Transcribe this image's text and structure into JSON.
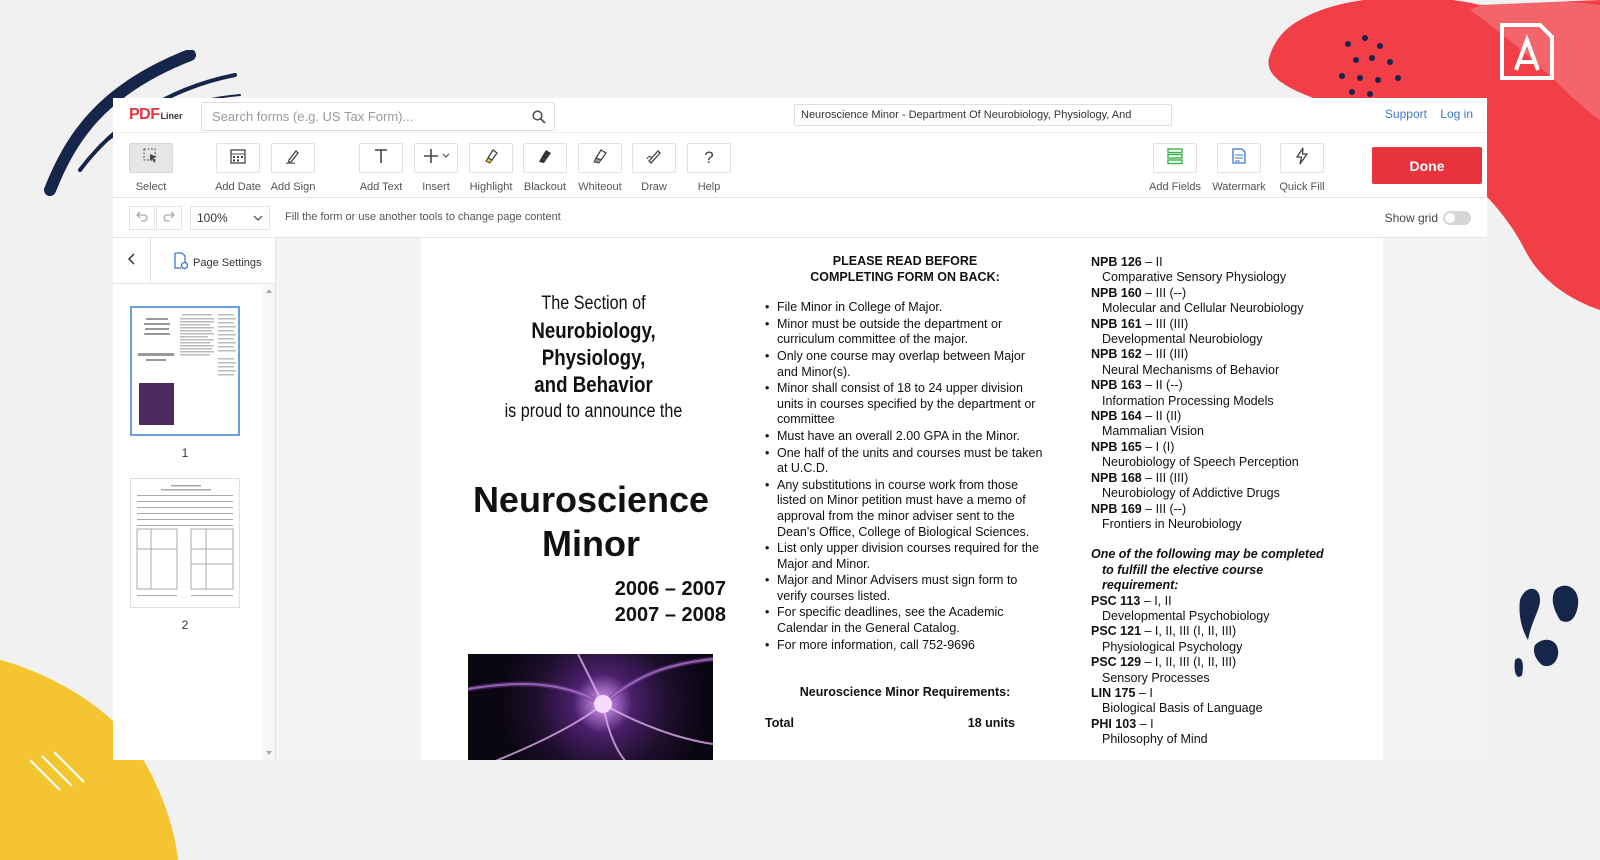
{
  "topbar": {
    "logo_pdf": "PDF",
    "logo_liner": "Liner",
    "search_placeholder": "Search forms (e.g. US Tax Form)...",
    "doc_title": "Neuroscience Minor - Department Of Neurobiology, Physiology, And",
    "links": [
      "Support",
      "Log in"
    ]
  },
  "toolbar": {
    "tools": [
      {
        "label": "Select",
        "icon": "select-icon"
      },
      {
        "label": "Add Date",
        "icon": "calendar-icon"
      },
      {
        "label": "Add Sign",
        "icon": "sign-icon"
      },
      {
        "label": "Add Text",
        "icon": "text-icon"
      },
      {
        "label": "Insert",
        "icon": "plus-icon"
      },
      {
        "label": "Highlight",
        "icon": "highlight-icon"
      },
      {
        "label": "Blackout",
        "icon": "blackout-icon"
      },
      {
        "label": "Whiteout",
        "icon": "whiteout-icon"
      },
      {
        "label": "Draw",
        "icon": "draw-icon"
      },
      {
        "label": "Help",
        "icon": "help-icon"
      },
      {
        "label": "Add Fields",
        "icon": "fields-icon"
      },
      {
        "label": "Watermark",
        "icon": "watermark-icon"
      },
      {
        "label": "Quick Fill",
        "icon": "lightning-icon"
      }
    ],
    "done_label": "Done"
  },
  "subbar": {
    "zoom": "100%",
    "hint": "Fill the form or use another tools to change page content",
    "show_grid_label": "Show grid"
  },
  "sidebar": {
    "page_settings_label": "Page Settings",
    "pages": [
      "1",
      "2"
    ]
  },
  "document": {
    "intro": {
      "line1": "The Section of",
      "line2": "Neurobiology,",
      "line3": "Physiology,",
      "line4": "and Behavior",
      "line5": "is proud to announce the"
    },
    "big_title_1": "Neuroscience",
    "big_title_2": "Minor",
    "years": [
      "2006 – 2007",
      "2007 – 2008"
    ],
    "read_header_1": "PLEASE READ BEFORE",
    "read_header_2": "COMPLETING FORM ON BACK:",
    "bullets": [
      "File Minor in College of Major.",
      "Minor must be outside the department or curriculum committee of the major.",
      "Only one course may overlap between Major and Minor(s).",
      "Minor shall consist of 18 to 24 upper division units in courses specified by the department or committee",
      "Must have an overall 2.00 GPA in the Minor.",
      "One half of the units and courses must be taken at U.C.D.",
      "Any substitutions in course work from those listed on Minor petition must have a memo of approval from the minor adviser sent to the Dean's Office, College of Biological Sciences.",
      "List only upper division courses required for the Major and Minor.",
      "Major and Minor Advisers must sign form to verify courses listed.",
      "For specific deadlines, see the Academic Calendar in the General Catalog.",
      "For more information, call 752-9696"
    ],
    "requirements_header": "Neuroscience Minor Requirements:",
    "total_label": "Total",
    "total_value": "18 units",
    "courses": [
      {
        "code": "NPB 126",
        "terms": " – II",
        "desc": "Comparative Sensory Physiology"
      },
      {
        "code": "NPB 160",
        "terms": " – III (--)",
        "desc": "Molecular and Cellular Neurobiology"
      },
      {
        "code": "NPB 161",
        "terms": " – III (III)",
        "desc": "Developmental Neurobiology"
      },
      {
        "code": "NPB 162",
        "terms": " – III (III)",
        "desc": "Neural Mechanisms of Behavior"
      },
      {
        "code": "NPB 163",
        "terms": " – II (--)",
        "desc": "Information Processing Models"
      },
      {
        "code": "NPB 164",
        "terms": " – II (II)",
        "desc": "Mammalian Vision"
      },
      {
        "code": "NPB 165",
        "terms": " – I (I)",
        "desc": "Neurobiology of Speech Perception"
      },
      {
        "code": "NPB 168",
        "terms": " – III (III)",
        "desc": "Neurobiology of Addictive Drugs"
      },
      {
        "code": "NPB 169",
        "terms": " – III (--)",
        "desc": "Frontiers in Neurobiology"
      }
    ],
    "elective_1": "One of the following may be completed",
    "elective_2": "to fulfill the elective course",
    "elective_3": "requirement:",
    "electives": [
      {
        "code": "PSC 113",
        "terms": " – I, II",
        "desc": "Developmental Psychobiology"
      },
      {
        "code": "PSC 121",
        "terms": " – I, II, III (I, II, III)",
        "desc": "Physiological Psychology"
      },
      {
        "code": "PSC 129",
        "terms": " – I, II, III (I, II, III)",
        "desc": "Sensory Processes"
      },
      {
        "code": "LIN 175",
        "terms": " – I",
        "desc": "Biological Basis of Language"
      },
      {
        "code": "PHI 103",
        "terms": " – I",
        "desc": "Philosophy of Mind"
      }
    ]
  },
  "colors": {
    "accent": "#e8333f",
    "link": "#3b79c7",
    "deco_yellow": "#f5c531",
    "deco_navy": "#16264a"
  }
}
